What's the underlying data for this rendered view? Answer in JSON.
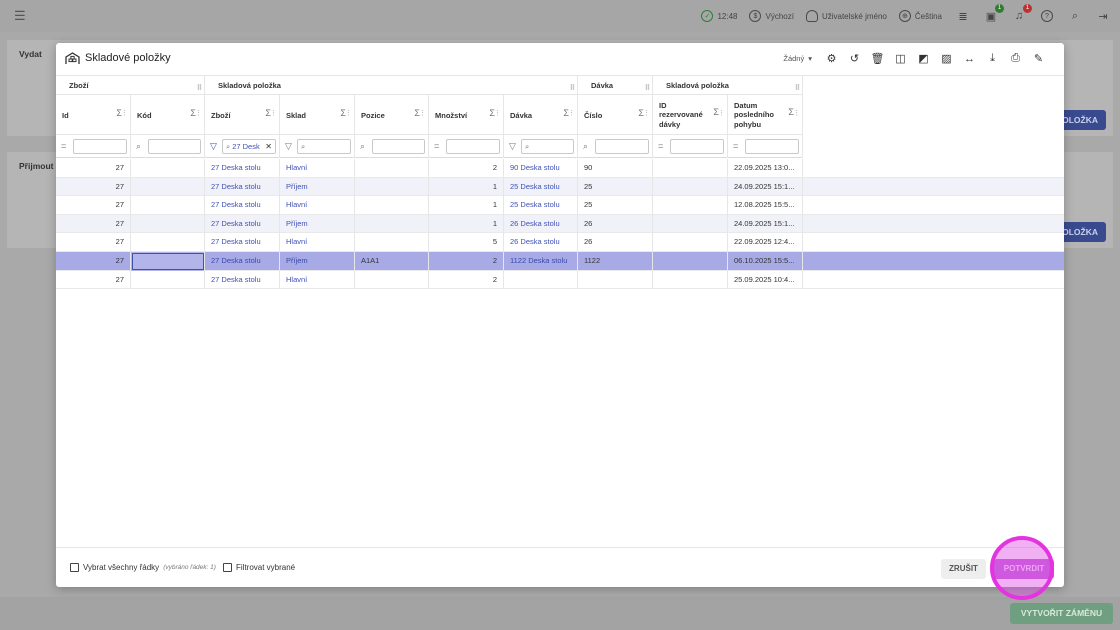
{
  "topbar": {
    "time": "12:48",
    "currency": "Výchozí",
    "username": "Uživatelské jméno",
    "language": "Čeština",
    "badge_box": "1",
    "badge_bell": "1"
  },
  "background": {
    "panel1_title": "Vydat",
    "panel2_title": "Přijmout",
    "panel_button": "POLOŽKA",
    "bottom_button": "VYTVOŘIT ZÁMĚNU"
  },
  "modal": {
    "title": "Skladové položky",
    "view_select": "Žádný",
    "groups": {
      "zbozi": "Zboží",
      "skladova1": "Skladová položka",
      "davka": "Dávka",
      "skladova2": "Skladová položka"
    },
    "columns": {
      "id": "Id",
      "kod": "Kód",
      "zbozi": "Zboží",
      "sklad": "Sklad",
      "pozice": "Pozice",
      "mnozstvi": "Množství",
      "davka": "Dávka",
      "cislo": "Číslo",
      "id_rez": [
        "ID",
        "rezervované",
        "dávky"
      ],
      "datum": [
        "Datum",
        "posledního",
        "pohybu"
      ]
    },
    "filter_zbozi": "27 Desk",
    "rows": [
      {
        "id": "27",
        "kod": "",
        "zbozi": "27 Deska stolu",
        "sklad": "Hlavní",
        "pozice": "",
        "mnozstvi": "2",
        "davka": "90 Deska stolu",
        "cislo": "90",
        "idrez": "",
        "datum": "22.09.2025 13:0..."
      },
      {
        "id": "27",
        "kod": "",
        "zbozi": "27 Deska stolu",
        "sklad": "Příjem",
        "pozice": "",
        "mnozstvi": "1",
        "davka": "25 Deska stolu",
        "cislo": "25",
        "idrez": "",
        "datum": "24.09.2025 15:1..."
      },
      {
        "id": "27",
        "kod": "",
        "zbozi": "27 Deska stolu",
        "sklad": "Hlavní",
        "pozice": "",
        "mnozstvi": "1",
        "davka": "25 Deska stolu",
        "cislo": "25",
        "idrez": "",
        "datum": "12.08.2025 15:5..."
      },
      {
        "id": "27",
        "kod": "",
        "zbozi": "27 Deska stolu",
        "sklad": "Příjem",
        "pozice": "",
        "mnozstvi": "1",
        "davka": "26 Deska stolu",
        "cislo": "26",
        "idrez": "",
        "datum": "24.09.2025 15:1..."
      },
      {
        "id": "27",
        "kod": "",
        "zbozi": "27 Deska stolu",
        "sklad": "Hlavní",
        "pozice": "",
        "mnozstvi": "5",
        "davka": "26 Deska stolu",
        "cislo": "26",
        "idrez": "",
        "datum": "22.09.2025 12:4..."
      },
      {
        "id": "27",
        "kod": "",
        "zbozi": "27 Deska stolu",
        "sklad": "Příjem",
        "pozice": "A1A1",
        "mnozstvi": "2",
        "davka": "1122 Deska stolu",
        "cislo": "1122",
        "idrez": "",
        "datum": "06.10.2025 15:5..."
      },
      {
        "id": "27",
        "kod": "",
        "zbozi": "27 Deska stolu",
        "sklad": "Hlavní",
        "pozice": "",
        "mnozstvi": "2",
        "davka": "",
        "cislo": "",
        "idrez": "",
        "datum": "25.09.2025 10:4..."
      }
    ],
    "footer": {
      "select_all": "Vybrat všechny řádky",
      "selected_count": "(vybráno řádek: 1)",
      "filter_selected": "Filtrovat vybrané",
      "cancel": "ZRUŠIT",
      "confirm": "POTVRDIT"
    }
  }
}
